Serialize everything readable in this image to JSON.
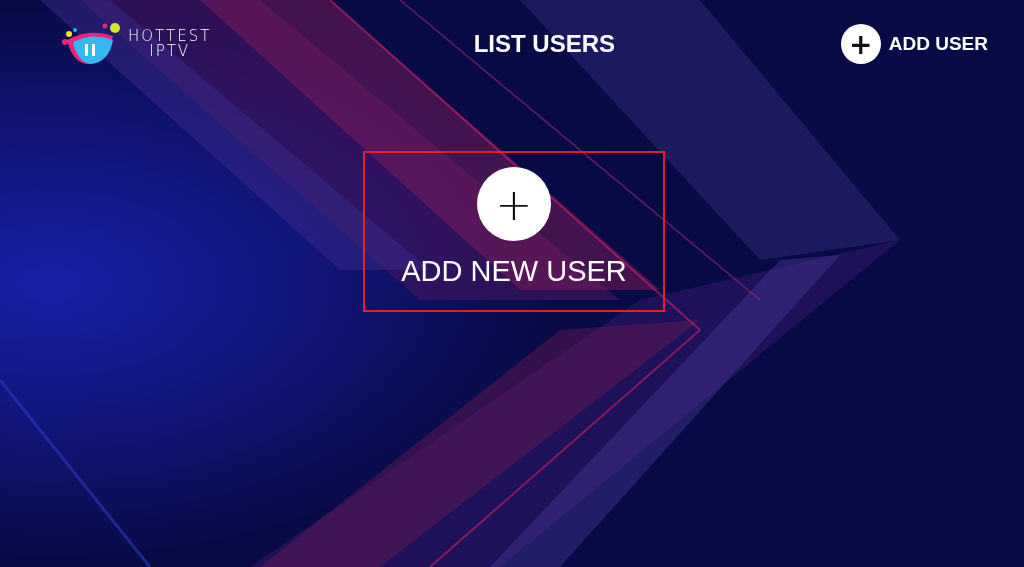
{
  "header": {
    "logo": {
      "line_1": "HOTTEST",
      "line_2": "IPTV"
    },
    "title": "LIST USERS",
    "add_button": {
      "icon": "+",
      "label": "ADD USER"
    }
  },
  "add_new_user": {
    "icon": "+",
    "label": "ADD NEW USER",
    "selected": true
  }
}
